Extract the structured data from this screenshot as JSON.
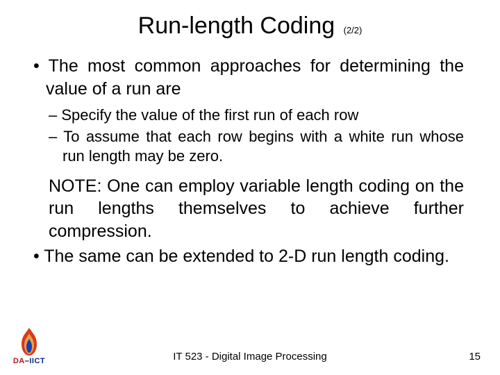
{
  "title": {
    "main": "Run-length Coding",
    "page_indicator": "(2/2)"
  },
  "content": {
    "intro": "• The most common approaches for determining the value of a run are",
    "sub1": "– Specify the value of the first run of each row",
    "sub2": "– To assume that each row begins with a white run whose run length may be zero.",
    "note": "NOTE: One can employ variable length coding on the run lengths themselves to achieve further compression.",
    "extend": "• The same can be extended to 2-D run length coding."
  },
  "footer": {
    "course": "IT 523 - Digital Image Processing",
    "page": "15"
  },
  "logo": {
    "da": "DA",
    "dash": "–",
    "iict": "IICT"
  }
}
